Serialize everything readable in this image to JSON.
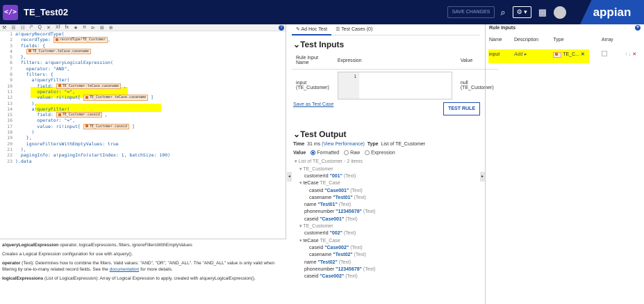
{
  "header": {
    "logo_glyph": "</>",
    "title": "TE_Test02",
    "save_label": "SAVE CHANGES",
    "search_icon": "search-icon",
    "gear_label": "⚙ ▾",
    "grid_icon": "grid-icon",
    "brand": "appian"
  },
  "editor": {
    "toolbar_icons": [
      "⚒",
      "☰",
      "☷",
      "/*",
      "Q",
      "✕",
      "Xf",
      "fx",
      "★",
      "π",
      "⊳",
      "⊞",
      "⊕"
    ],
    "lines": [
      {
        "n": "1",
        "t": "a!queryRecordType("
      },
      {
        "n": "2",
        "t": "  recordType: ",
        "rec": "recordType!TE_Customer",
        "after": ","
      },
      {
        "n": "3",
        "t": "  fields: {"
      },
      {
        "n": "4",
        "t": "    ",
        "rec": "TE_Customer.teCase.casename"
      },
      {
        "n": "5",
        "t": "  },"
      },
      {
        "n": "6",
        "t": "  filters: a!queryLogicalExpression("
      },
      {
        "n": "7",
        "t": "    operator: \"AND\","
      },
      {
        "n": "8",
        "t": "    filters: {"
      },
      {
        "n": "9",
        "t": "      a!queryFilter("
      },
      {
        "n": "10",
        "t": "        field: ",
        "rec": "TE_Customer.teCase.casename",
        "after": " ,"
      },
      {
        "n": "11",
        "t": "        operator: \"=\","
      },
      {
        "n": "12",
        "t": "        value: ri!input[ ",
        "rec": "TE_Customer.teCase.casename",
        "after": " ]"
      },
      {
        "n": "13",
        "t": "      ),"
      },
      {
        "n": "14",
        "t": "      a!queryFilter("
      },
      {
        "n": "15",
        "t": "        field: ",
        "rec": "TE_Customer.caseid",
        "after": " ,"
      },
      {
        "n": "16",
        "t": "        operator: \"=\","
      },
      {
        "n": "17",
        "t": "        value: ri!input[ ",
        "rec": "TE_Customer.caseid",
        "after": " ]"
      },
      {
        "n": "18",
        "t": "      )"
      },
      {
        "n": "19",
        "t": "    },"
      },
      {
        "n": "20",
        "t": "    ignoreFiltersWithEmptyValues: true"
      },
      {
        "n": "21",
        "t": "  ),"
      },
      {
        "n": "22",
        "t": "  pagingInfo: a!pagingInfo(startIndex: 1, batchSize: 100)"
      },
      {
        "n": "23",
        "t": ").data"
      }
    ]
  },
  "docs": {
    "sig_name": "a!queryLogicalExpression",
    "sig_params": " operator, logicalExpressions, filters, ignoreFiltersWithEmptyValues",
    "desc": "Creates a Logical Expression configuration for use with a!query().",
    "op_name": "operator",
    "op_text": " (Text): Determines how to combine the filters. Valid values: \"AND\", \"OR\", \"AND_ALL\". The \"AND_ALL\" value is only valid when filtering by one-to-many related record fields. See the ",
    "op_link": "documentation",
    "op_tail": " for more details.",
    "le_name": "logicalExpressions",
    "le_text": " (List of LogicalExpression): Array of Logical Expression to apply, created with a!queryLogicalExpression()."
  },
  "middle": {
    "tab1": "Ad Hoc Test",
    "tab2": "Test Cases (0)",
    "inputs_title": "Test Inputs",
    "col_name": "Rule Input Name",
    "col_expr": "Expression",
    "col_value": "Value",
    "row_name": "input",
    "row_type": "(TE_Customer)",
    "row_line": "1",
    "row_value": "null (TE_Customer)",
    "save_link": "Save as Test Case",
    "test_btn": "TEST RULE",
    "output_title": "Test Output",
    "time_label": "Time",
    "time_val": "31 ms",
    "perf_link": "(View Performance)",
    "type_label": "Type",
    "type_val": "List of TE_Customer",
    "value_label": "Value",
    "opt_formatted": "Formatted",
    "opt_raw": "Raw",
    "opt_expression": "Expression",
    "tree": [
      {
        "indent": 0,
        "arrow": "▾",
        "key": "List of TE_Customer - 2 items",
        "gray": true
      },
      {
        "indent": 1,
        "arrow": "▾",
        "key": "TE_Customer",
        "gray": true
      },
      {
        "indent": 2,
        "key": "customerId ",
        "val": "\"001\"",
        "type": " (Text)"
      },
      {
        "indent": 1,
        "arrow": "▾",
        "key": "teCase ",
        "type": "TE_Case"
      },
      {
        "indent": 3,
        "key": "caseid ",
        "val": "\"Case001\"",
        "type": " (Text)"
      },
      {
        "indent": 3,
        "key": "casename ",
        "val": "\"Test01\"",
        "type": " (Text)"
      },
      {
        "indent": 2,
        "key": "name ",
        "val": "\"Test01\"",
        "type": " (Text)"
      },
      {
        "indent": 2,
        "key": "phonenumber ",
        "val": "\"12345678\"",
        "type": " (Text)"
      },
      {
        "indent": 2,
        "key": "caseid ",
        "val": "\"Case001\"",
        "type": " (Text)"
      },
      {
        "indent": 1,
        "arrow": "▾",
        "key": "TE_Customer",
        "gray": true
      },
      {
        "indent": 2,
        "key": "customerId ",
        "val": "\"002\"",
        "type": " (Text)"
      },
      {
        "indent": 1,
        "arrow": "▾",
        "key": "teCase ",
        "type": "TE_Case"
      },
      {
        "indent": 3,
        "key": "caseid ",
        "val": "\"Case002\"",
        "type": " (Text)"
      },
      {
        "indent": 3,
        "key": "casename ",
        "val": "\"Test02\"",
        "type": " (Text)"
      },
      {
        "indent": 2,
        "key": "name ",
        "val": "\"Test02\"",
        "type": " (Text)"
      },
      {
        "indent": 2,
        "key": "phonenumber ",
        "val": "\"12345678\"",
        "type": " (Text)"
      },
      {
        "indent": 2,
        "key": "caseid ",
        "val": "\"Case002\"",
        "type": " (Text)"
      }
    ]
  },
  "right": {
    "title": "Rule Inputs",
    "col_name": "Name",
    "col_desc": "Description",
    "col_type": "Type",
    "col_array": "Array",
    "row_name": "input",
    "row_desc": "Add",
    "row_type": "TE_C...",
    "highlight_color": "#ffff00"
  }
}
